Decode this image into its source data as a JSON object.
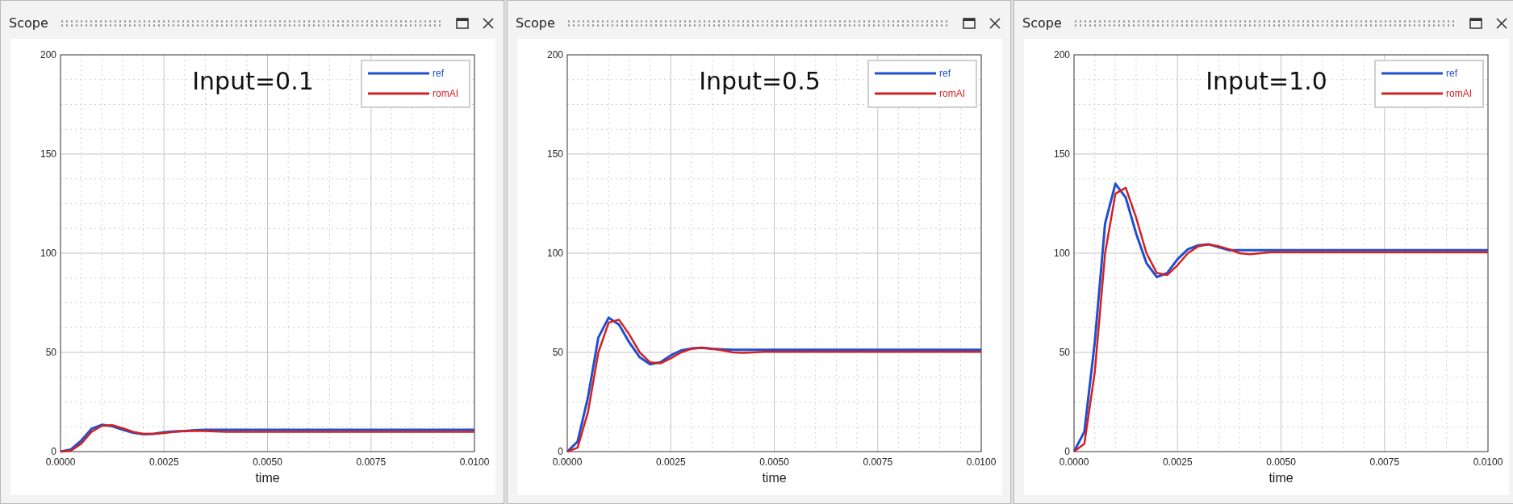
{
  "panels": [
    {
      "title": "Scope",
      "chart_data": {
        "type": "line",
        "title": "Input=0.1",
        "xlabel": "time",
        "grid": true,
        "x": [
          0,
          0.00025,
          0.0005,
          0.00075,
          0.001,
          0.00125,
          0.0015,
          0.00175,
          0.002,
          0.00225,
          0.0025,
          0.00275,
          0.003,
          0.00325,
          0.0035,
          0.00375,
          0.004,
          0.00425,
          0.0045,
          0.00475,
          0.005,
          0.0075,
          0.01
        ],
        "series": [
          {
            "name": "ref",
            "color": "#1f4fd0",
            "values": [
              0,
              1,
              5.5,
              11.5,
              13.5,
              12.8,
              11,
              9.5,
              8.8,
              9,
              9.7,
              10.2,
              10.4,
              10.8,
              11,
              11,
              11,
              11,
              11,
              11,
              11,
              11,
              11
            ]
          },
          {
            "name": "romAI",
            "color": "#d42020",
            "values": [
              0,
              0.4,
              4,
              10,
              13,
              13.3,
              11.8,
              10,
              9,
              8.9,
              9.4,
              10,
              10.4,
              10.5,
              10.4,
              10.2,
              10,
              10,
              10,
              10,
              10,
              10,
              10
            ]
          }
        ],
        "xlim": [
          0,
          0.01
        ],
        "ylim": [
          0,
          200
        ],
        "yticks": [
          0,
          50,
          100,
          150,
          200
        ],
        "xticks": [
          {
            "value": 0,
            "label": "0.0000"
          },
          {
            "value": 0.0025,
            "label": "0.0025"
          },
          {
            "value": 0.005,
            "label": "0.0050"
          },
          {
            "value": 0.0075,
            "label": "0.0075"
          },
          {
            "value": 0.01,
            "label": "0.0100"
          }
        ]
      }
    },
    {
      "title": "Scope",
      "chart_data": {
        "type": "line",
        "title": "Input=0.5",
        "xlabel": "time",
        "grid": true,
        "x": [
          0,
          0.00025,
          0.0005,
          0.00075,
          0.001,
          0.00125,
          0.0015,
          0.00175,
          0.002,
          0.00225,
          0.0025,
          0.00275,
          0.003,
          0.00325,
          0.0035,
          0.00375,
          0.004,
          0.00425,
          0.0045,
          0.00475,
          0.005,
          0.0075,
          0.01
        ],
        "series": [
          {
            "name": "ref",
            "color": "#1f4fd0",
            "values": [
              0,
              5,
              27.5,
              57.5,
              67.5,
              64,
              55,
              47.5,
              44,
              45,
              48.5,
              51,
              52,
              52.3,
              51.8,
              51.5,
              51.3,
              51.3,
              51.3,
              51.3,
              51.3,
              51.3,
              51.3
            ]
          },
          {
            "name": "romAI",
            "color": "#d42020",
            "values": [
              0,
              2,
              20,
              50,
              65,
              66.5,
              59,
              50,
              45,
              44.5,
              47,
              50,
              51.8,
              52.3,
              51.8,
              51,
              50,
              49.8,
              50,
              50.3,
              50.3,
              50.3,
              50.3
            ]
          }
        ],
        "xlim": [
          0,
          0.01
        ],
        "ylim": [
          0,
          200
        ],
        "yticks": [
          0,
          50,
          100,
          150,
          200
        ],
        "xticks": [
          {
            "value": 0,
            "label": "0.0000"
          },
          {
            "value": 0.0025,
            "label": "0.0025"
          },
          {
            "value": 0.005,
            "label": "0.0050"
          },
          {
            "value": 0.0075,
            "label": "0.0075"
          },
          {
            "value": 0.01,
            "label": "0.0100"
          }
        ]
      }
    },
    {
      "title": "Scope",
      "chart_data": {
        "type": "line",
        "title": "Input=1.0",
        "xlabel": "time",
        "grid": true,
        "x": [
          0,
          0.00025,
          0.0005,
          0.00075,
          0.001,
          0.00125,
          0.0015,
          0.00175,
          0.002,
          0.00225,
          0.0025,
          0.00275,
          0.003,
          0.00325,
          0.0035,
          0.00375,
          0.004,
          0.00425,
          0.0045,
          0.00475,
          0.005,
          0.0075,
          0.01
        ],
        "series": [
          {
            "name": "ref",
            "color": "#1f4fd0",
            "values": [
              0,
              10,
              55,
              115,
              135,
              128,
              110,
              95,
              88,
              90,
              97,
              102,
              104,
              104.5,
              103,
              101.5,
              101.5,
              101.5,
              101.5,
              101.5,
              101.5,
              101.5,
              101.5
            ]
          },
          {
            "name": "romAI",
            "color": "#d42020",
            "values": [
              0,
              4,
              40,
              100,
              130,
              133,
              118,
              100,
              90,
              89,
              94,
              100,
              103.5,
              104.5,
              103.5,
              102,
              100,
              99.5,
              100,
              100.5,
              100.5,
              100.5,
              100.5
            ]
          }
        ],
        "xlim": [
          0,
          0.01
        ],
        "ylim": [
          0,
          200
        ],
        "yticks": [
          0,
          50,
          100,
          150,
          200
        ],
        "xticks": [
          {
            "value": 0,
            "label": "0.0000"
          },
          {
            "value": 0.0025,
            "label": "0.0025"
          },
          {
            "value": 0.005,
            "label": "0.0050"
          },
          {
            "value": 0.0075,
            "label": "0.0075"
          },
          {
            "value": 0.01,
            "label": "0.0100"
          }
        ]
      }
    }
  ]
}
